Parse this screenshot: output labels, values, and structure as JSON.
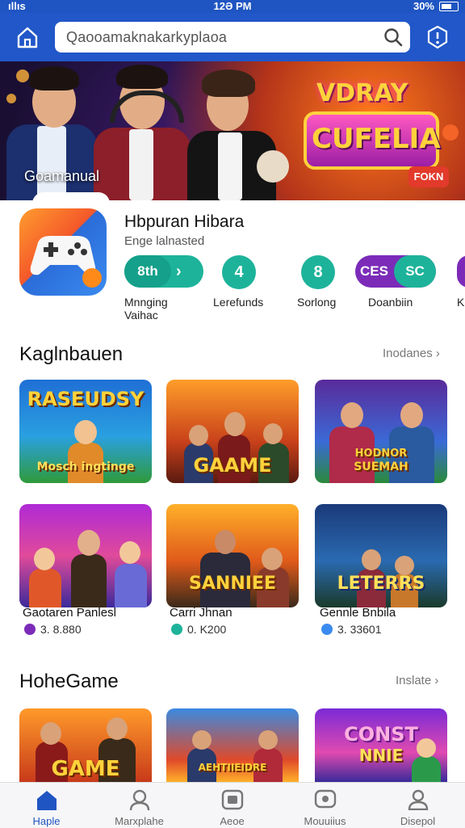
{
  "status_bar": {
    "left": "ıllıs",
    "time": "12Ə PM",
    "battery": "30%"
  },
  "header": {
    "search": {
      "text": "Qaooamaknakarkyplaoa"
    }
  },
  "banner": {
    "caption": "Goamanual",
    "logo_top": "VDRAY",
    "logo_main": "CUFELIA",
    "button": "FOKN"
  },
  "app": {
    "name": "Hbpuran Hibara",
    "subtitle": "Enge lalnasted",
    "stats": [
      {
        "value": "8th",
        "label_line1": "Mnnging",
        "label_line2": "Vaihac",
        "color": "#1db39a"
      },
      {
        "value": "4",
        "label_line1": "Lerefunds",
        "color": "#1db39a"
      },
      {
        "value": "8",
        "label_line1": "Sorlong",
        "color": "#1db39a"
      },
      {
        "value": "CES",
        "value2": "SC",
        "label_line1": "Doanbiin",
        "color": "#7b2bb8"
      },
      {
        "label_line1": "K"
      }
    ]
  },
  "section1": {
    "title": "Kaglnbauen",
    "more": "Inodanes",
    "cards": [
      {
        "text": "RASEUDSY",
        "text2": "Mosch ingtinge"
      },
      {
        "text": "GAAME"
      },
      {
        "text": "HODNOR",
        "text2": "SUEMAH"
      },
      {
        "text": "",
        "name": "Gaotaren Panlesl",
        "meta": "3. 8.880",
        "meta_color": "#7b2bb8"
      },
      {
        "text": "SANNIEE",
        "name": "Carri Jhnan",
        "meta": "0. K200",
        "meta_color": "#1db39a"
      },
      {
        "text": "LETERRS",
        "name": "Gennle Bnbila",
        "meta": "3. 33601",
        "meta_color": "#3a8bf0"
      }
    ]
  },
  "section2": {
    "title": "HoheGame",
    "more": "Inslate",
    "cards": [
      {
        "text": "GAME"
      },
      {
        "text": "AEHTIIEIDRE"
      },
      {
        "text": "CONST",
        "text2": "NNIE"
      }
    ]
  },
  "bottom_nav": [
    {
      "label": "Haple",
      "icon": "home-icon",
      "active": true
    },
    {
      "label": "Marxplahe",
      "icon": "profile-icon"
    },
    {
      "label": "Aeoe",
      "icon": "gamepad-icon"
    },
    {
      "label": "Mouuiius",
      "icon": "chat-icon"
    },
    {
      "label": "Disepol",
      "icon": "user-icon"
    }
  ],
  "colors": {
    "primary": "#2157c8",
    "accent_teal": "#1db39a",
    "accent_purple": "#7b2bb8"
  }
}
